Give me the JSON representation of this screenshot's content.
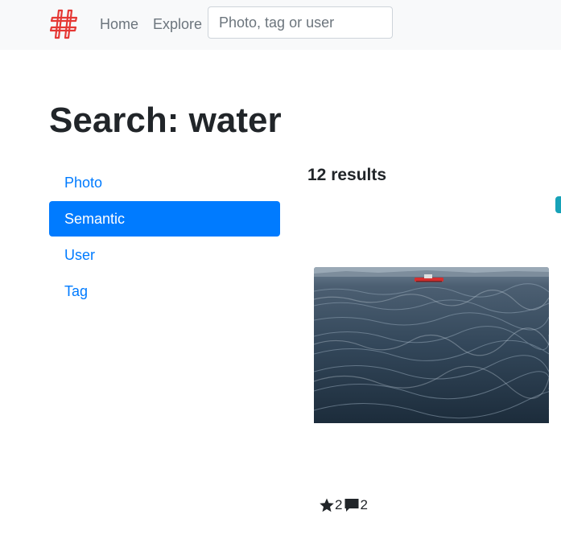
{
  "navbar": {
    "logo_icon": "hashtag-logo-icon",
    "links": [
      "Home",
      "Explore"
    ],
    "search_placeholder": "Photo, tag or user"
  },
  "page": {
    "title": "Search: water"
  },
  "search_types": [
    {
      "label": "Photo",
      "active": false
    },
    {
      "label": "Semantic",
      "active": true
    },
    {
      "label": "User",
      "active": false
    },
    {
      "label": "Tag",
      "active": false
    }
  ],
  "results": {
    "count_label": "12 results",
    "items": [
      {
        "image": "sea-waves-with-red-boat",
        "stars": "2",
        "comments": "2"
      }
    ]
  },
  "colors": {
    "primary": "#007bff",
    "navbar_bg": "#f8f9fa",
    "muted": "#6c757d",
    "accent_tab": "#17a2b8",
    "logo_red": "#e53935"
  }
}
